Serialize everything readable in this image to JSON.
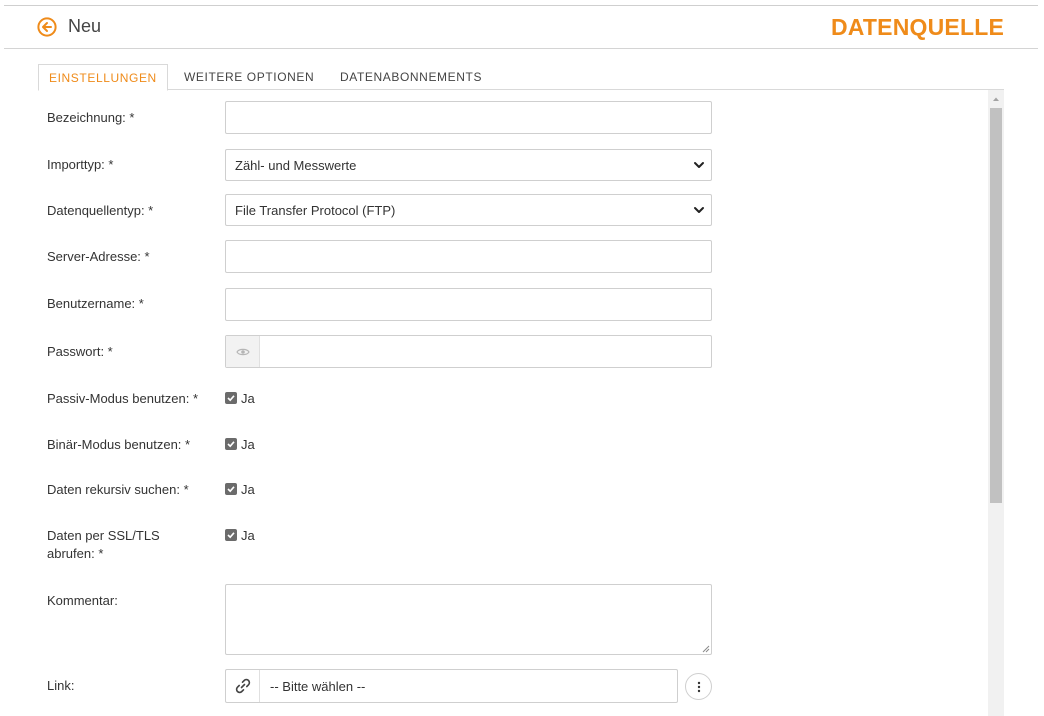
{
  "header": {
    "back_label": "Neu",
    "title": "DATENQUELLE"
  },
  "tabs": [
    {
      "label": "EINSTELLUNGEN",
      "active": true
    },
    {
      "label": "WEITERE OPTIONEN",
      "active": false
    },
    {
      "label": "DATENABONNEMENTS",
      "active": false
    }
  ],
  "form": {
    "bezeichnung": {
      "label": "Bezeichnung: *",
      "value": ""
    },
    "importtyp": {
      "label": "Importtyp: *",
      "value": "Zähl- und Messwerte"
    },
    "datenquellentyp": {
      "label": "Datenquellentyp: *",
      "value": "File Transfer Protocol (FTP)"
    },
    "server_adresse": {
      "label": "Server-Adresse: *",
      "value": ""
    },
    "benutzername": {
      "label": "Benutzername: *",
      "value": ""
    },
    "passwort": {
      "label": "Passwort: *",
      "value": ""
    },
    "passiv_modus": {
      "label": "Passiv-Modus benutzen: *",
      "option": "Ja",
      "checked": true
    },
    "binaer_modus": {
      "label": "Binär-Modus benutzen: *",
      "option": "Ja",
      "checked": true
    },
    "rekursiv": {
      "label": "Daten rekursiv suchen: *",
      "option": "Ja",
      "checked": true
    },
    "ssl_tls": {
      "label_line1": "Daten per SSL/TLS",
      "label_line2": "abrufen: *",
      "option": "Ja",
      "checked": true
    },
    "kommentar": {
      "label": "Kommentar:",
      "value": ""
    },
    "link": {
      "label": "Link:",
      "value": "-- Bitte wählen --"
    }
  },
  "colors": {
    "accent": "#ef8b1a",
    "text": "#333333",
    "border": "#cfcfcf"
  },
  "icons": {
    "back": "arrow-left-circle-icon",
    "password_toggle": "eye-icon",
    "link": "chain-link-icon",
    "more": "vertical-dots-icon",
    "select": "chevron-down-icon"
  }
}
